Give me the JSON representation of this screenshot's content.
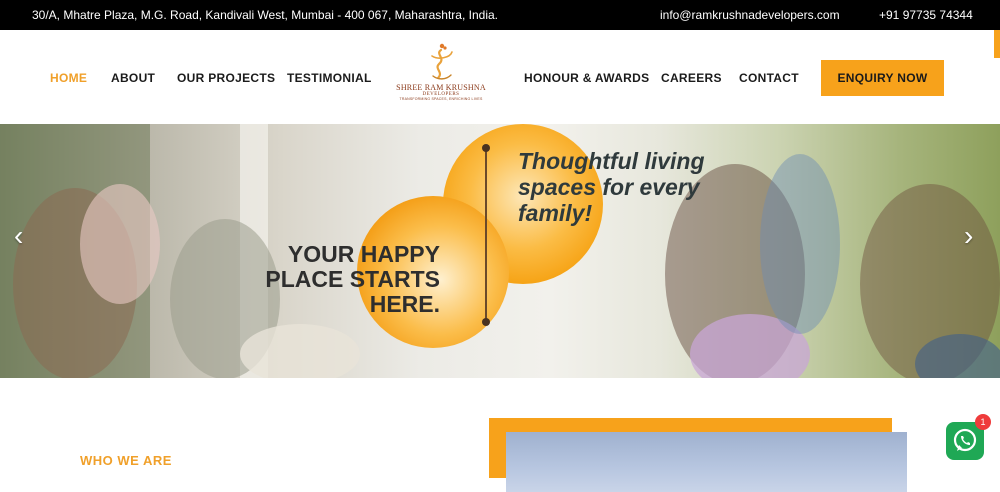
{
  "topbar": {
    "address": "30/A, Mhatre Plaza, M.G. Road, Kandivali West, Mumbai - 400 067, Maharashtra, India.",
    "email": "info@ramkrushnadevelopers.com",
    "phone": "+91 97735 74344"
  },
  "nav": {
    "left": [
      "HOME",
      "ABOUT",
      "OUR PROJECTS",
      "TESTIMONIAL"
    ],
    "right": [
      "HONOUR & AWARDS",
      "CAREERS",
      "CONTACT"
    ],
    "active": "HOME",
    "cta": "ENQUIRY NOW"
  },
  "logo": {
    "name": "SHREE RAM KRUSHNA",
    "sub": "DEVELOPERS",
    "tagline": "TRANSFORMING SPACES, ENRICHING LIVES"
  },
  "hero": {
    "left_line1": "YOUR HAPPY",
    "left_line2": "PLACE STARTS",
    "left_line3": "HERE.",
    "right_line1": "Thoughtful living",
    "right_line2": "spaces for every",
    "right_line3": "family!",
    "prev_icon": "chevron-left-icon",
    "next_icon": "chevron-right-icon"
  },
  "section": {
    "who_we_are": "WHO WE ARE"
  },
  "whatsapp": {
    "icon": "whatsapp-icon",
    "badge": "1"
  },
  "colors": {
    "accent": "#f7a21b",
    "topbar": "#000000",
    "active_nav": "#f0a02a"
  }
}
